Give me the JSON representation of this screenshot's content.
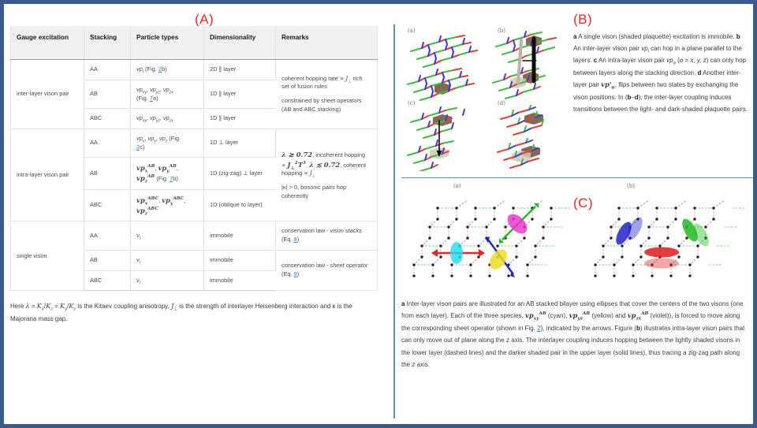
{
  "panel_tags": {
    "a": "(A)",
    "b": "(B)",
    "c": "(C)"
  },
  "colors": {
    "frame_blue": "#3a5a8c",
    "divider_blue": "#5b8fc9",
    "tag_red": "#ff2020",
    "header_bg": "#f1f1f1",
    "link_blue": "#3a7ebf",
    "bond_green": "#33bb33",
    "bond_red": "#ee3322",
    "bond_blue": "#3333dd",
    "plaquette_dark": "#6b5437",
    "plaquette_light": "#cfc6b4",
    "ellipse_cyan": "#22ddee",
    "ellipse_magenta": "#ee33cc",
    "ellipse_yellow": "#eedd22",
    "ellipse_blue": "#2222cc",
    "ellipse_green": "#22bb22",
    "ellipse_red": "#dd2222",
    "arrow_red": "#ee2222",
    "arrow_green": "#22bb22",
    "arrow_blue": "#2222cc"
  },
  "table": {
    "headers": [
      "Gauge excitation",
      "Stacking",
      "Particle types",
      "Dimensionality",
      "Remarks"
    ],
    "groups": [
      {
        "excitation": "inter-layer vison pair",
        "rows": [
          {
            "stacking": "AA",
            "particles": "vp_l (Fig. 2b)",
            "dimensionality": "2D ∥ layer"
          },
          {
            "stacking": "AB",
            "particles": "vp_xy, vp_yz, vp_zx (Fig. 7a)",
            "dimensionality": "1D ∥ layer"
          },
          {
            "stacking": "ABC",
            "particles": "vp_xy, vp_yz, vp_zx",
            "dimensionality": "1D ∥ layer"
          }
        ],
        "remarks": [
          "coherent hopping rate ∝ J⊥ rich set of fusion rules",
          "constrained by sheet operators (AB and ABC stacking)"
        ]
      },
      {
        "excitation": "intra-layer vison pair",
        "rows": [
          {
            "stacking": "AA",
            "particles": "vp_x, vp_y, vp_z (Fig. 2c)",
            "dimensionality": "1D ⊥ layer"
          },
          {
            "stacking": "AB",
            "particles": "vp_x^AB, vp_y^AB, vp_z^AB (Fig. 7b)",
            "dimensionality": "1D (zig-zag) ⊥ layer"
          },
          {
            "stacking": "ABC",
            "particles": "vp_x^ABC, vp_y^ABC, vp_z^ABC",
            "dimensionality": "1D (oblique to layer)"
          }
        ],
        "remarks": [
          "λ ≳ 0.72, incoherent hopping ∝ J⊥²T³, λ ≲ 0.72, coherent hopping ∝ J⊥",
          "|κ| > 0, bosonic pairs hop coherently"
        ]
      },
      {
        "excitation": "single vison",
        "rows": [
          {
            "stacking": "AA",
            "particles": "v_l",
            "dimensionality": "immobile"
          },
          {
            "stacking": "AB",
            "particles": "v_l",
            "dimensionality": "immobile"
          },
          {
            "stacking": "ABC",
            "particles": "v_l",
            "dimensionality": "immobile"
          }
        ],
        "remarks": [
          "conservation law - vison stacks (Eq. 8)",
          "conservation law - sheet operator (Eq. 9)"
        ]
      }
    ],
    "footnote": "Here λ = Kx/Kz = Ky/Kz is the Kitaev coupling anisotropy, J⊥ is the strength of interlayer Heisenberg interaction and κ is the Majorana mass gap."
  },
  "panelB": {
    "subtags": [
      "(a)",
      "(b)",
      "(c)",
      "(d)"
    ],
    "caption": "a A single vison (shaded plaquette) excitation is immobile. b An inter-layer vison pair vpₗ can hop in a plane parallel to the layers. c An intra-layer vison pair vpα (α = x, y, z) can only hop between layers along the stacking direction. d Another inter-layer pair vp'α, flips between two states by exchanging the vison positions. In (b–d), the inter-layer coupling induces transitions between the light- and dark-shaded plaquette pairs."
  },
  "panelC": {
    "subtags": [
      "(a)",
      "(b)"
    ],
    "caption": "a Inter-layer vison pairs are illustrated for an AB stacked bilayer using ellipses that cover the centers of the two visons (one from each layer). Each of the three species, vp_xy^AB (cyan), vp_yz^AB (yellow) and vp_zx^AB (violet)), is forced to move along the corresponding sheet operator (shown in Fig. 2), indicated by the arrows. Figure (b) illustrates intra-layer vison pairs that can only move out of plane along the z axis. The interlayer coupling induces hopping between the lightly shaded visons in the lower layer (dashed lines) and the darker shaded pair in the upper layer (solid lines), thus tracing a zig-zag path along the z axis."
  }
}
